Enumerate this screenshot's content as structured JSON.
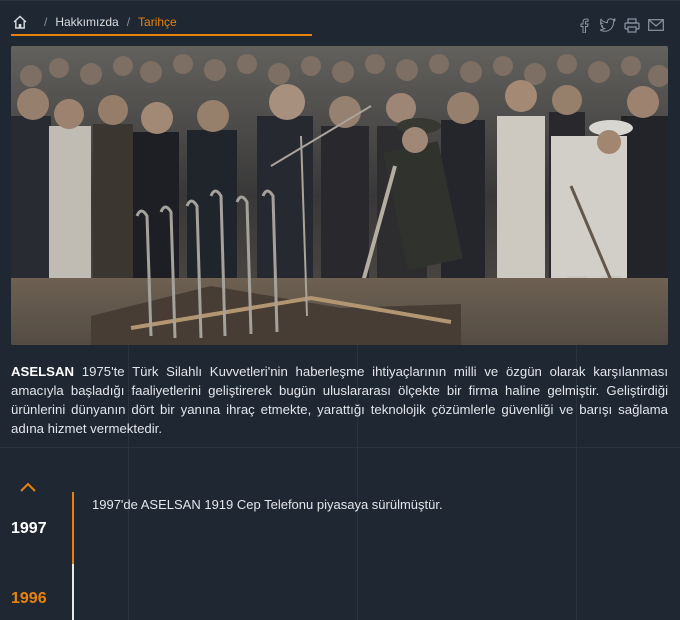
{
  "breadcrumb": {
    "items": [
      {
        "label": "Hakkımızda"
      },
      {
        "label": "Tarihçe"
      }
    ]
  },
  "share": {
    "icons": [
      "facebook-icon",
      "twitter-icon",
      "print-icon",
      "mail-icon"
    ]
  },
  "intro": {
    "brand": "ASELSAN",
    "text": " 1975'te Türk Silahlı Kuvvetleri'nin haberleşme ihtiyaçlarının milli ve özgün olarak karşılanması amacıyla başladığı faaliyetlerini geliştirerek bugün uluslararası ölçekte bir firma haline gelmiştir. Geliştirdiği ürünlerini dünyanın dört bir yanına ihraç etmekte, yarattığı teknolojik çözümlerle güvenliği ve barışı sağlama adına hizmet vermektedir."
  },
  "timeline": {
    "current_year": "1997",
    "current_text": "1997'de ASELSAN 1919 Cep Telefonu piyasaya sürülmüştür.",
    "next_year": "1996"
  },
  "colors": {
    "accent": "#e8820c",
    "background": "#1f2733"
  }
}
